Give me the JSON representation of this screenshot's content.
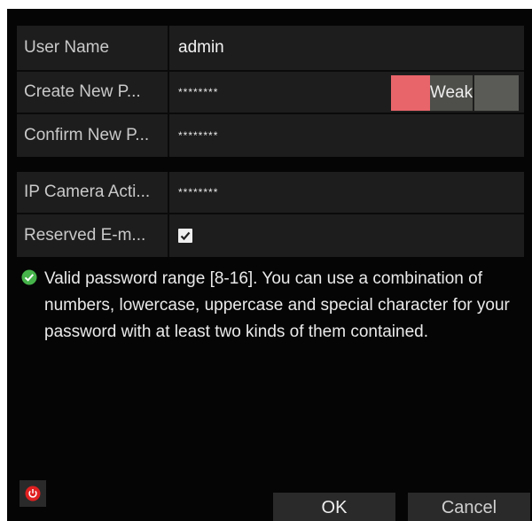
{
  "form": {
    "username_label": "User Name",
    "username_value": "admin",
    "new_password_label": "Create New P...",
    "new_password_mask": "********",
    "password_strength": "Weak",
    "confirm_password_label": "Confirm New P...",
    "confirm_password_mask": "********",
    "ip_camera_label": "IP Camera Acti...",
    "ip_camera_mask": "********",
    "reserved_email_label": "Reserved E-m...",
    "reserved_email_checked": true
  },
  "hint": {
    "text": "Valid password range [8-16]. You can use a combination of numbers, lowercase, uppercase and special character for your password with at least two kinds of them contained."
  },
  "footer": {
    "ok_label": "OK",
    "cancel_label": "Cancel"
  },
  "colors": {
    "strength_weak": "#e8656a",
    "hint_icon": "#45b34a",
    "power_icon": "#e02020"
  },
  "icons": {
    "hint": "check-circle-icon",
    "power": "power-icon",
    "checkbox": "checkmark-icon"
  }
}
